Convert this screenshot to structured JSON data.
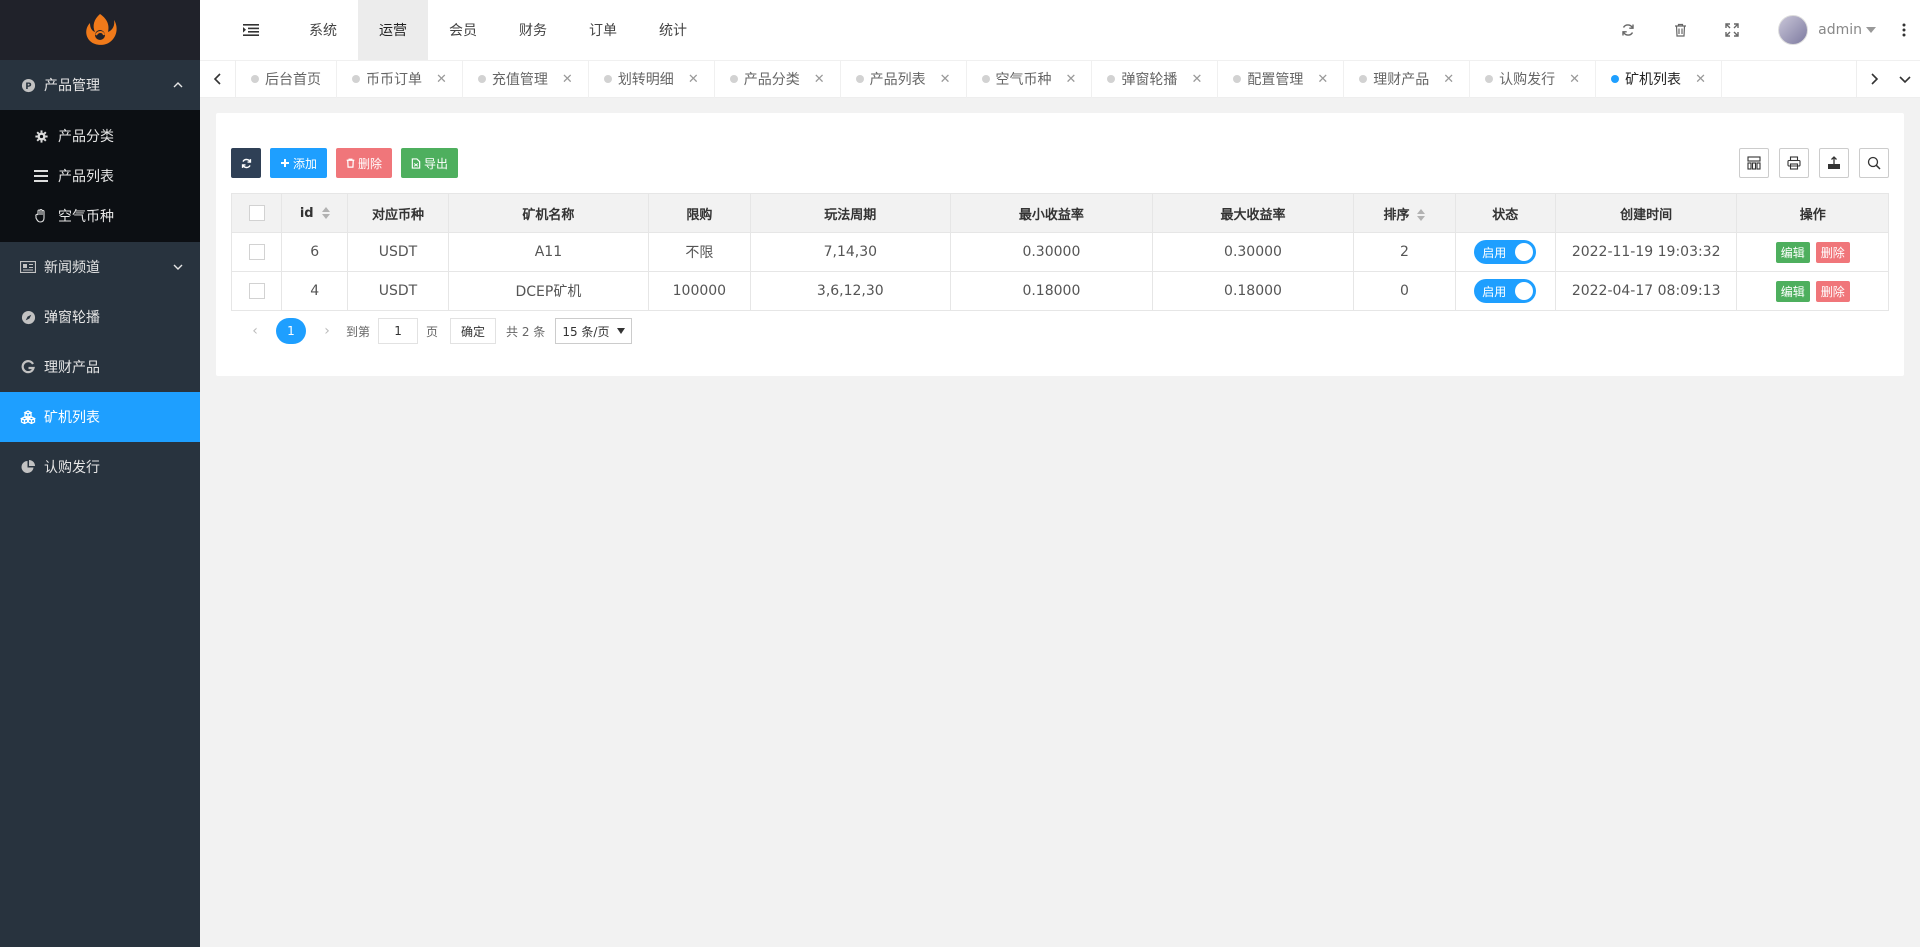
{
  "sidebar": {
    "groups": [
      {
        "label": "产品管理",
        "icon": "p-circle-icon",
        "open": true,
        "items": [
          {
            "label": "产品分类",
            "icon": "gear-icon"
          },
          {
            "label": "产品列表",
            "icon": "list-icon"
          },
          {
            "label": "空气币种",
            "icon": "hand-icon"
          }
        ]
      },
      {
        "label": "新闻频道",
        "icon": "news-icon"
      },
      {
        "label": "弹窗轮播",
        "icon": "compass-icon"
      },
      {
        "label": "理财产品",
        "icon": "g-icon"
      },
      {
        "label": "矿机列表",
        "icon": "cubes-icon",
        "active": true
      },
      {
        "label": "认购发行",
        "icon": "pie-chart-icon"
      }
    ]
  },
  "header": {
    "nav": [
      "系统",
      "运营",
      "会员",
      "财务",
      "订单",
      "统计"
    ],
    "active_nav": "运营",
    "user": "admin"
  },
  "tabs": [
    {
      "label": "后台首页",
      "closable": false
    },
    {
      "label": "币币订单",
      "closable": true
    },
    {
      "label": "充值管理",
      "closable": true
    },
    {
      "label": "划转明细",
      "closable": true
    },
    {
      "label": "产品分类",
      "closable": true
    },
    {
      "label": "产品列表",
      "closable": true
    },
    {
      "label": "空气币种",
      "closable": true
    },
    {
      "label": "弹窗轮播",
      "closable": true
    },
    {
      "label": "配置管理",
      "closable": true
    },
    {
      "label": "理财产品",
      "closable": true
    },
    {
      "label": "认购发行",
      "closable": true
    },
    {
      "label": "矿机列表",
      "closable": true,
      "active": true
    }
  ],
  "toolbar": {
    "add_label": "添加",
    "delete_label": "删除",
    "export_label": "导出"
  },
  "table": {
    "columns": [
      "id",
      "对应币种",
      "矿机名称",
      "限购",
      "玩法周期",
      "最小收益率",
      "最大收益率",
      "排序",
      "状态",
      "创建时间",
      "操作"
    ],
    "rows": [
      {
        "id": "6",
        "coin": "USDT",
        "name": "A11",
        "limit": "不限",
        "cycle": "7,14,30",
        "min_rate": "0.30000",
        "max_rate": "0.30000",
        "sort": "2",
        "status": "启用",
        "created": "2022-11-19 19:03:32"
      },
      {
        "id": "4",
        "coin": "USDT",
        "name": "DCEP矿机",
        "limit": "100000",
        "cycle": "3,6,12,30",
        "min_rate": "0.18000",
        "max_rate": "0.18000",
        "sort": "0",
        "status": "启用",
        "created": "2022-04-17 08:09:13"
      }
    ],
    "edit_label": "编辑",
    "delete_label": "删除"
  },
  "pager": {
    "current": "1",
    "goto_label": "到第",
    "goto_value": "1",
    "page_unit": "页",
    "confirm_label": "确定",
    "total_label": "共 2 条",
    "page_size": "15 条/页"
  },
  "colors": {
    "sidebar_bg": "#28333e",
    "submenu_bg": "#0c0f13",
    "active_blue": "#1e9fff",
    "btn_dark": "#2f4056",
    "btn_red": "#f0767a",
    "btn_green": "#4eaf5e",
    "logo_orange": "#f07a1a"
  }
}
